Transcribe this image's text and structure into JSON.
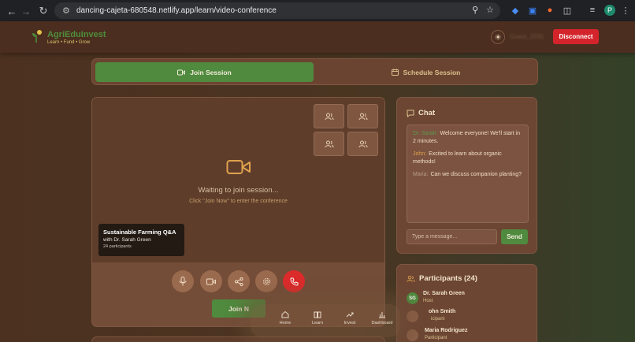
{
  "browser": {
    "url": "dancing-cajeta-680548.netlify.app/learn/video-conference",
    "profile_initial": "P"
  },
  "header": {
    "brand": "AgriEduInvest",
    "tagline": "Learn • Fund • Grow",
    "user_label": "Guest_2031",
    "disconnect_label": "Disconnect"
  },
  "tabs": {
    "join_label": "Join Session",
    "schedule_label": "Schedule Session"
  },
  "video": {
    "waiting_text": "Waiting to join session...",
    "hint_text": "Click \"Join Now\" to enter the conference",
    "session_title": "Sustainable Farming Q&A",
    "session_host": "with Dr. Sarah Green",
    "session_count": "24 participants",
    "join_label": "Join N"
  },
  "chat": {
    "title": "Chat",
    "messages": [
      {
        "who": "Dr. Sarah:",
        "text": "Welcome everyone! We'll start in 2 minutes."
      },
      {
        "who": "John:",
        "text": "Excited to learn about organic methods!"
      },
      {
        "who": "Maria:",
        "text": "Can we discuss companion planting?"
      }
    ],
    "input_placeholder": "Type a message...",
    "send_label": "Send"
  },
  "participants": {
    "title": "Participants (24)",
    "list": [
      {
        "initials": "SG",
        "name": "Dr. Sarah Green",
        "role": "Host"
      },
      {
        "initials": "",
        "name": "ohn Smith",
        "role": "icipant"
      },
      {
        "initials": "",
        "name": "Maria Rodriguez",
        "role": "Participant"
      }
    ]
  },
  "bottom_nav": {
    "home": "Home",
    "learn": "Learn",
    "invest": "Invest",
    "dashboard": "Dashboard"
  },
  "colors": {
    "accent_green": "#4f8a3e",
    "danger_red": "#d4242b",
    "panel_brown": "#6c4633"
  }
}
